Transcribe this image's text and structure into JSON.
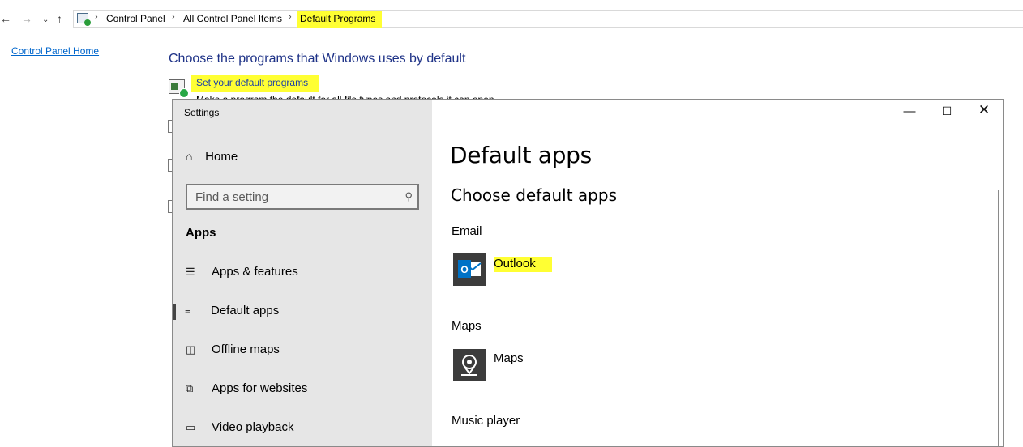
{
  "address_bar": {
    "crumbs": [
      "Control Panel",
      "All Control Panel Items",
      "Default Programs"
    ]
  },
  "control_panel": {
    "home_link": "Control Panel Home",
    "heading": "Choose the programs that Windows uses by default",
    "default_link": "Set your default programs",
    "subtext": "Make a program the default for all file types and protocols it can open."
  },
  "settings": {
    "title": "Settings",
    "home": "Home",
    "search_placeholder": "Find a setting",
    "section": "Apps",
    "nav": [
      {
        "label": "Apps & features",
        "icon": "list-icon"
      },
      {
        "label": "Default apps",
        "icon": "default-apps-icon"
      },
      {
        "label": "Offline maps",
        "icon": "map-icon"
      },
      {
        "label": "Apps for websites",
        "icon": "open-window-icon"
      },
      {
        "label": "Video playback",
        "icon": "video-icon"
      }
    ],
    "selected_nav": "Default apps",
    "page_title": "Default apps",
    "subheading": "Choose default apps",
    "categories": [
      {
        "label": "Email",
        "app": "Outlook"
      },
      {
        "label": "Maps",
        "app": "Maps"
      },
      {
        "label": "Music player"
      }
    ]
  },
  "colors": {
    "highlight": "#ffff33",
    "sidebar_bg": "#e6e6e6",
    "outlook_blue": "#0072c6",
    "link_blue": "#0066cc",
    "heading_blue": "#1e3287"
  }
}
